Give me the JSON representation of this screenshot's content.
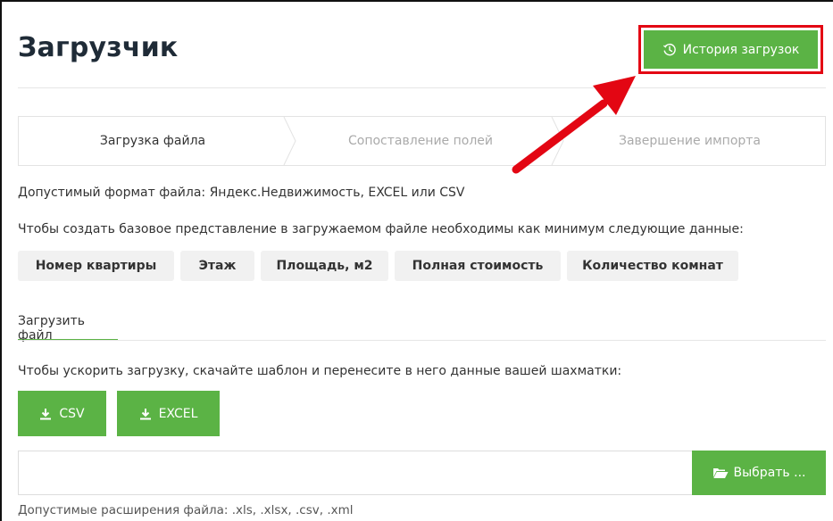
{
  "header": {
    "title": "Загрузчик",
    "history_button": "История загрузок"
  },
  "steps": [
    "Загрузка файла",
    "Сопоставление полей",
    "Завершение импорта"
  ],
  "active_step": 1,
  "info": {
    "formats": "Допустимый формат файла: Яндекс.Недвижимость, EXCEL или CSV",
    "required": "Чтобы создать базовое представление в загружаемом файле необходимы как минимум следующие данные:"
  },
  "required_fields": [
    "Номер квартиры",
    "Этаж",
    "Площадь, м2",
    "Полная стоимость",
    "Количество комнат"
  ],
  "tab": {
    "label": "Загрузить файл"
  },
  "template": {
    "text": "Чтобы ускорить загрузку, скачайте шаблон и перенесите в него данные вашей шахматки:",
    "csv_label": "CSV",
    "excel_label": "EXCEL"
  },
  "upload": {
    "value": "",
    "browse_label": "Выбрать ...",
    "extensions_hint": "Допустимые расширения файла: .xls, .xlsx, .csv, .xml"
  },
  "colors": {
    "accent": "#5bb345",
    "highlight": "#e30613",
    "text": "#333333",
    "muted": "#aaaaaa"
  },
  "icons": {
    "history": "history-clock-icon",
    "download": "download-icon",
    "folder": "folder-open-icon",
    "annotation": "red-arrow"
  }
}
